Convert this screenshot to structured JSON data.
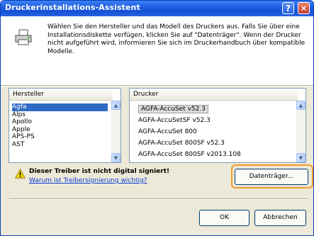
{
  "window": {
    "title": "Druckerinstallations-Assistent",
    "help_glyph": "?",
    "close_glyph": "✕"
  },
  "header": {
    "description": "Wählen Sie den Hersteller und das Modell des Druckers aus. Falls Sie über eine Installationsdiskette verfügen, klicken Sie auf \"Datenträger\". Wenn der Drucker nicht aufgeführt wird, informieren Sie sich im Druckerhandbuch über kompatible Modelle.",
    "icon": "printer-icon"
  },
  "manufacturer_list": {
    "header": "Hersteller",
    "items": [
      "Agfa",
      "Alps",
      "Apollo",
      "Apple",
      "APS-PS",
      "AST"
    ],
    "selected_index": 0
  },
  "driver_list": {
    "header": "Drucker",
    "items": [
      "AGFA-AccuSet v52.3",
      "AGFA-AccuSetSF v52.3",
      "AGFA-AccuSet 800",
      "AGFA-AccuSet 800SF v52.3",
      "AGFA-AccuSet 800SF v2013.108"
    ],
    "selected_index": 0
  },
  "warning": {
    "text": "Dieser Treiber ist nicht digital signiert!",
    "link": "Warum ist Treibersignierung wichtig?",
    "icon": "warning-icon"
  },
  "buttons": {
    "disk": "Datenträger...",
    "ok": "OK",
    "cancel": "Abbrechen"
  },
  "colors": {
    "titlebar": "#1f5fe0",
    "highlight_frame": "#f39a2b",
    "selection": "#316ac5",
    "link": "#0b3cd4"
  }
}
